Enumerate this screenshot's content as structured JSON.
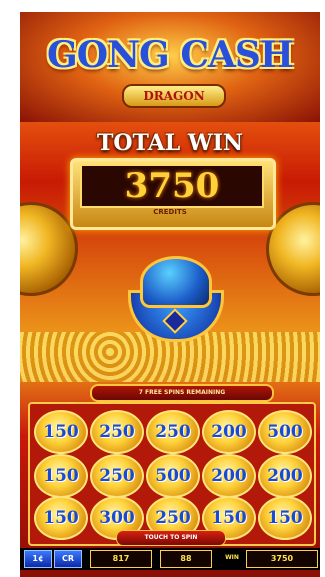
{
  "game": {
    "title": "GONG CASH",
    "subtitle": "DRAGON",
    "total_win_label": "TOTAL WIN",
    "total_win_value": "3750",
    "total_win_unit": "CREDITS",
    "free_spins_text": "7 FREE SPINS REMAINING",
    "touch_to_spin": "TOUCH TO SPIN"
  },
  "reels": [
    [
      "150",
      "250",
      "250",
      "200",
      "500"
    ],
    [
      "150",
      "250",
      "500",
      "200",
      "200"
    ],
    [
      "150",
      "300",
      "250",
      "150",
      "150"
    ]
  ],
  "bottom_bar": {
    "btn1": "1¢",
    "btn2": "CR",
    "field1": "817",
    "field2": "88",
    "win_label": "WIN",
    "win_value": "3750"
  },
  "colors": {
    "title": "#2a4fd8",
    "win_digits": "#ffd23a",
    "cell_number": "#1a4ad0"
  }
}
